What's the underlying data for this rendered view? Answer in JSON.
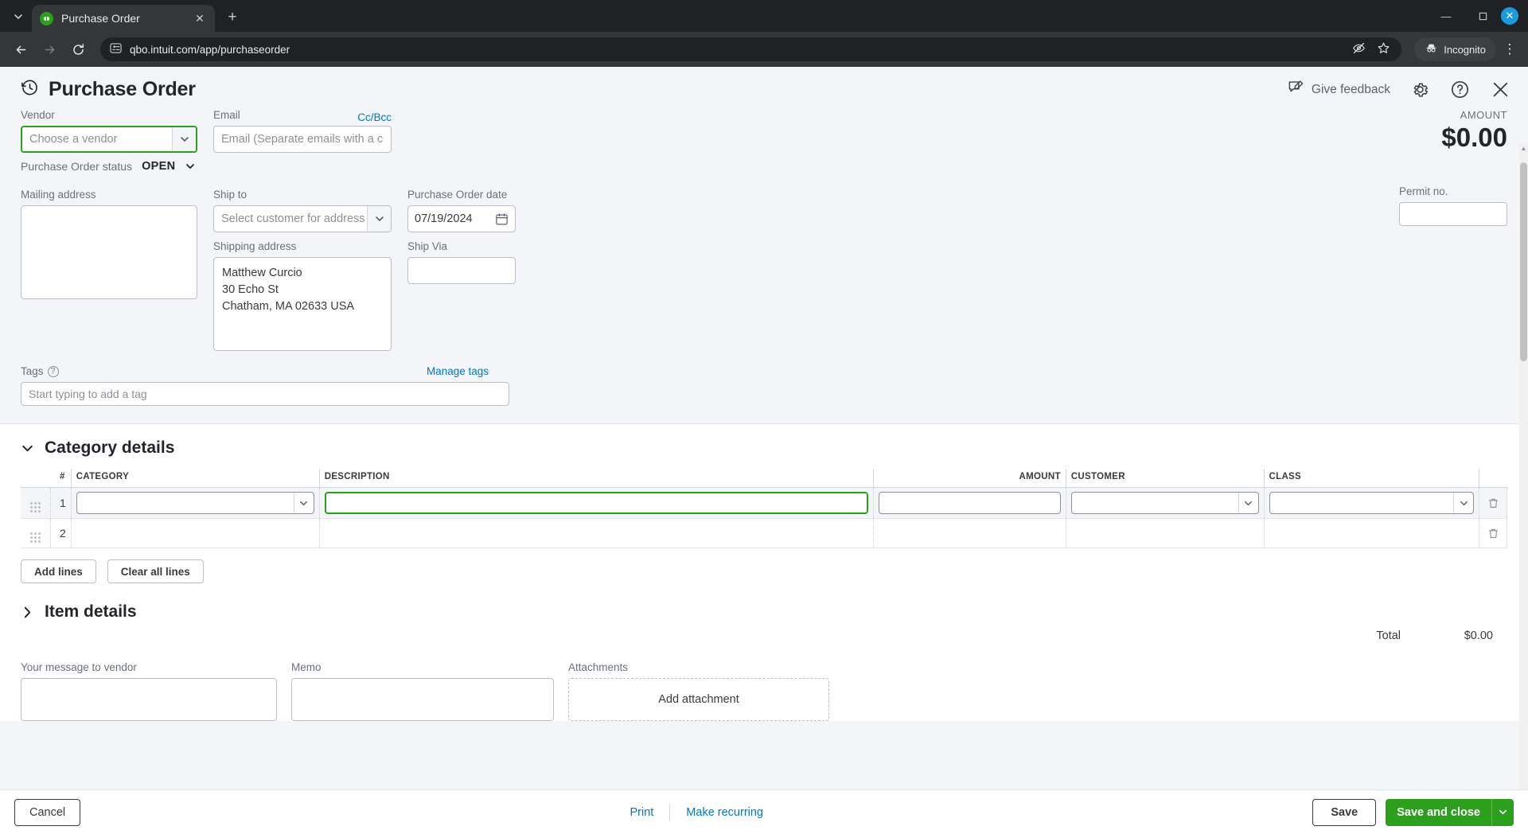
{
  "browser": {
    "tab": {
      "title": "Purchase Order",
      "favicon_label": "qb",
      "close_icon": "close-icon"
    },
    "newtab_icon": "plus-icon",
    "tablist_icon": "chevron-down-icon",
    "back_icon": "arrow-left-icon",
    "forward_icon": "arrow-right-icon",
    "reload_icon": "reload-icon",
    "site_info_icon": "site-settings-icon",
    "url": "qbo.intuit.com/app/purchaseorder",
    "hide_icon": "eye-slash-icon",
    "bookmark_icon": "star-icon",
    "incognito_label": "Incognito",
    "incognito_icon": "incognito-hat-icon",
    "menu_icon": "three-dots-icon",
    "window": {
      "minimize": "minimize-icon",
      "maximize": "maximize-icon",
      "close": "close-icon"
    }
  },
  "header": {
    "title": "Purchase Order",
    "history_icon": "clock-history-icon",
    "give_feedback": "Give feedback",
    "feedback_icon": "feedback-pencil-icon",
    "settings_icon": "gear-icon",
    "help_icon": "question-circle-icon",
    "close_icon": "close-icon"
  },
  "form": {
    "vendor_label": "Vendor",
    "vendor_placeholder": "Choose a vendor",
    "email_label": "Email",
    "cc_bcc_label": "Cc/Bcc",
    "email_placeholder": "Email (Separate emails with a comma)",
    "status_label": "Purchase Order status",
    "status_value": "OPEN",
    "amount_label": "AMOUNT",
    "amount_value": "$0.00",
    "mailing_label": "Mailing address",
    "mailing_value": "",
    "shipto_label": "Ship to",
    "shipto_placeholder": "Select customer for address",
    "shipping_label": "Shipping address",
    "shipping_line1": "Matthew Curcio",
    "shipping_line2": "30 Echo St",
    "shipping_line3": "Chatham, MA  02633 USA",
    "po_date_label": "Purchase Order date",
    "po_date_value": "07/19/2024",
    "calendar_icon": "calendar-icon",
    "ship_via_label": "Ship Via",
    "ship_via_value": "",
    "permit_label": "Permit no.",
    "permit_value": "",
    "tags_label": "Tags",
    "tags_help_icon": "question-mark-icon",
    "manage_tags": "Manage tags",
    "tags_placeholder": "Start typing to add a tag"
  },
  "category_details": {
    "title": "Category details",
    "collapse_icon": "chevron-down-icon",
    "columns": [
      "#",
      "CATEGORY",
      "DESCRIPTION",
      "AMOUNT",
      "CUSTOMER",
      "CLASS"
    ],
    "rows": [
      {
        "num": "1",
        "category": "",
        "description": "",
        "amount": "",
        "customer": "",
        "class": ""
      },
      {
        "num": "2",
        "category": "",
        "description": "",
        "amount": "",
        "customer": "",
        "class": ""
      }
    ],
    "drag_icon": "drag-handle-icon",
    "delete_icon": "trash-icon",
    "add_lines": "Add lines",
    "clear_all_lines": "Clear all lines"
  },
  "item_details": {
    "title": "Item details",
    "expand_icon": "chevron-right-icon"
  },
  "totals": {
    "total_label": "Total",
    "total_value": "$0.00"
  },
  "bottom": {
    "message_label": "Your message to vendor",
    "memo_label": "Memo",
    "attachments_label": "Attachments",
    "add_attachment": "Add attachment"
  },
  "footer": {
    "cancel": "Cancel",
    "print": "Print",
    "make_recurring": "Make recurring",
    "save": "Save",
    "save_and_close": "Save and close",
    "save_dropdown_icon": "chevron-down-icon"
  },
  "colors": {
    "brand_green": "#2ca01c",
    "link_blue": "#0077c5",
    "page_bg": "#f4f5f8",
    "text_dark": "#22252a"
  }
}
